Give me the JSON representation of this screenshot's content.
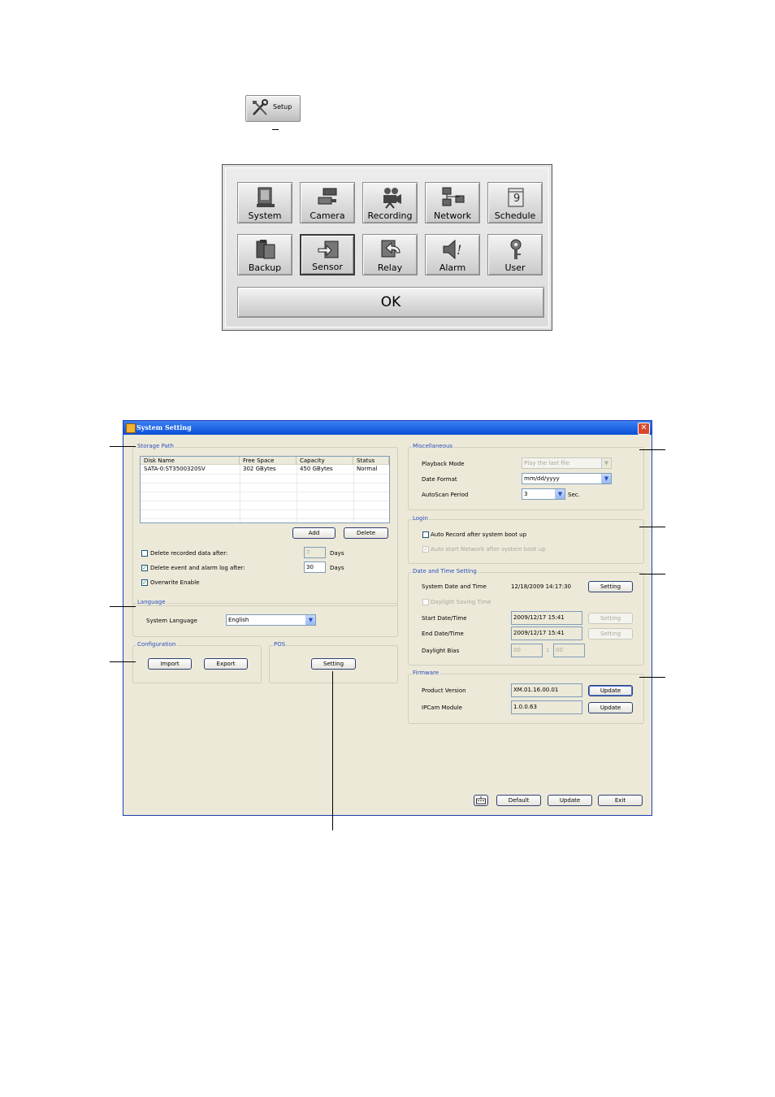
{
  "setup_button": {
    "label": "Setup"
  },
  "setup_menu": {
    "row1": [
      {
        "label": "System",
        "icon": "system-icon"
      },
      {
        "label": "Camera",
        "icon": "camera-icon"
      },
      {
        "label": "Recording",
        "icon": "recording-icon"
      },
      {
        "label": "Network",
        "icon": "network-icon"
      },
      {
        "label": "Schedule",
        "icon": "schedule-icon"
      }
    ],
    "row2": [
      {
        "label": "Backup",
        "icon": "backup-icon"
      },
      {
        "label": "Sensor",
        "icon": "sensor-icon",
        "selected": true
      },
      {
        "label": "Relay",
        "icon": "relay-icon"
      },
      {
        "label": "Alarm",
        "icon": "alarm-icon"
      },
      {
        "label": "User",
        "icon": "user-icon"
      }
    ],
    "ok_label": "OK"
  },
  "window": {
    "title": "System Setting",
    "close_glyph": "✕",
    "storage_path": {
      "title": "Storage Path",
      "columns": [
        "Disk Name",
        "Free Space",
        "Capacity",
        "Status"
      ],
      "rows": [
        [
          "SATA-0:ST3500320SV",
          "302 GBytes",
          "450 GBytes",
          "Normal"
        ]
      ],
      "add_label": "Add",
      "delete_label": "Delete",
      "delete_recorded": {
        "label": "Delete recorded data after:",
        "checked": false,
        "value": "7",
        "unit": "Days"
      },
      "delete_event": {
        "label": "Delete event and alarm log after:",
        "checked": true,
        "value": "30",
        "unit": "Days"
      },
      "overwrite": {
        "label": "Overwrite Enable",
        "checked": true
      }
    },
    "language": {
      "title": "Language",
      "label": "System Language",
      "value": "English"
    },
    "configuration": {
      "title": "Configuration",
      "import_label": "Import",
      "export_label": "Export"
    },
    "pos": {
      "title": "POS",
      "setting_label": "Setting"
    },
    "miscellaneous": {
      "title": "Miscellaneous",
      "playback_mode": {
        "label": "Playback Mode",
        "value": "Play the last file"
      },
      "date_format": {
        "label": "Date Format",
        "value": "mm/dd/yyyy"
      },
      "autoscan": {
        "label": "AutoScan Period",
        "value": "3",
        "unit": "Sec."
      }
    },
    "login": {
      "title": "Login",
      "auto_record": "Auto Record after system boot up",
      "auto_network": "Auto start Network after system boot up"
    },
    "datetime": {
      "title": "Date and Time Setting",
      "system_label": "System Date and Time",
      "system_value": "12/18/2009 14:17:30",
      "setting_label": "Setting",
      "dst_label": "Daylight Saving Time",
      "start_label": "Start Date/Time",
      "start_value": "2009/12/17 15:41",
      "end_label": "End Date/Time",
      "end_value": "2009/12/17 15:41",
      "bias_label": "Daylight Bias",
      "bias_h": "00",
      "bias_sep": ":",
      "bias_m": "00"
    },
    "firmware": {
      "title": "Firmware",
      "product_label": "Product Version",
      "product_value": "XM.01.16.00.01",
      "ipcam_label": "IPCam Module",
      "ipcam_value": "1.0.0.63",
      "update_label": "Update"
    },
    "bottom": {
      "default_label": "Default",
      "update_label": "Update",
      "exit_label": "Exit"
    }
  }
}
